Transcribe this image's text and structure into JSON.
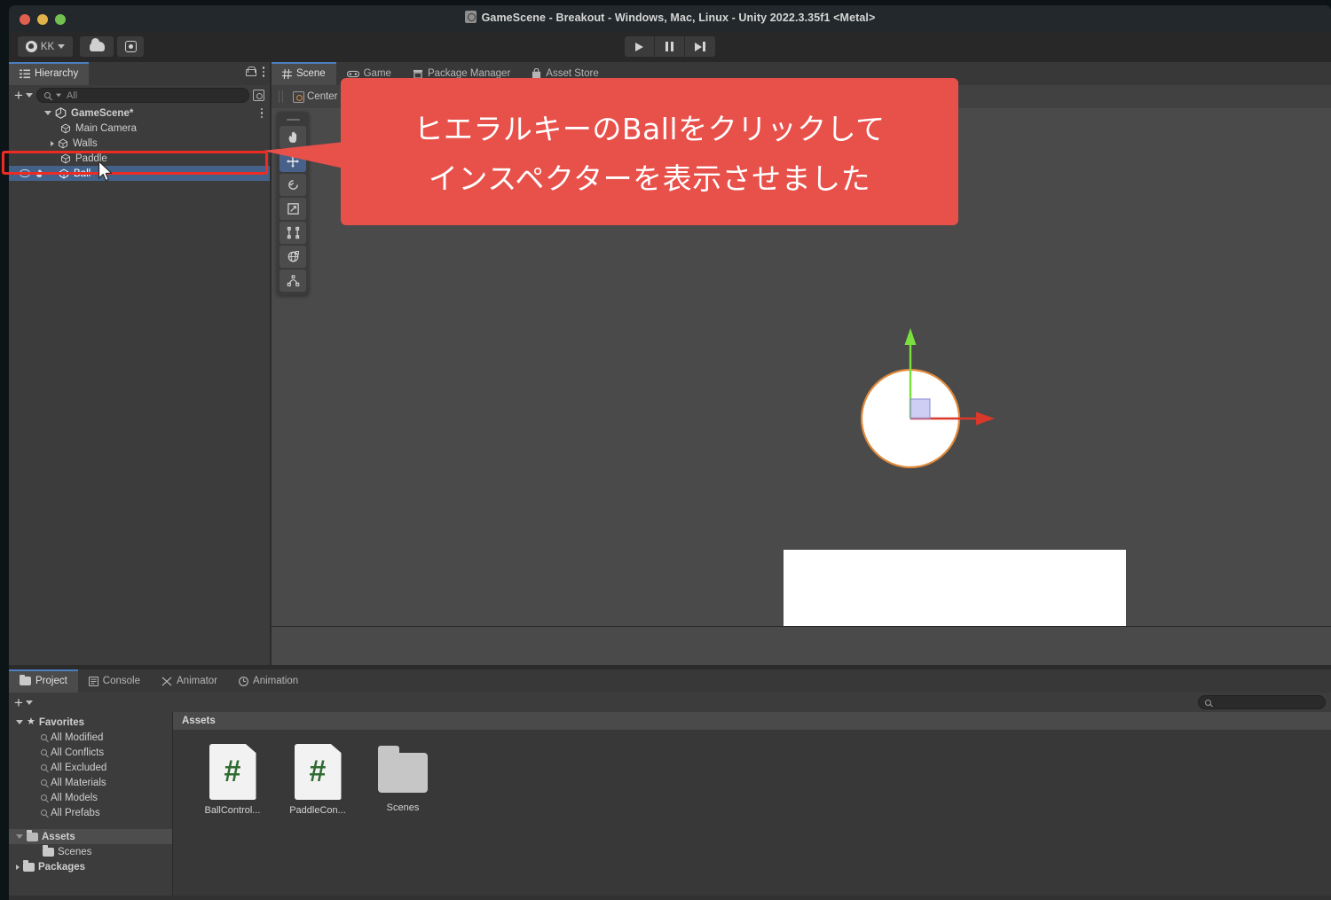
{
  "window": {
    "title": "GameScene - Breakout - Windows, Mac, Linux - Unity 2022.3.35f1 <Metal>",
    "traffic_lights": [
      "close",
      "minimize",
      "zoom"
    ],
    "colors": {
      "titlebar_bg": "#22282b",
      "panel_bg": "#3c3c3c",
      "scene_bg": "#4a4a4a",
      "selection_blue": "#44618a",
      "accent_red": "#e8504a",
      "annotation_outline": "#ee2b22",
      "tab_active_bar": "#4a7fc1",
      "csharp_green": "#2f6b32"
    }
  },
  "main_toolbar": {
    "account_label": "KK",
    "account_icon": "avatar-icon",
    "cloud_icon": "cloud-icon",
    "settings_icon": "gear-icon",
    "play_icon": "play-icon",
    "pause_icon": "pause-icon",
    "step_icon": "step-icon"
  },
  "hierarchy": {
    "tab_label": "Hierarchy",
    "tab_icon": "hierarchy-icon",
    "lock_icon": "lock-icon",
    "menu_icon": "kebab-menu-icon",
    "add_label": "+",
    "search_placeholder": "All",
    "search_value": "",
    "expand_icon": "scene-vis-icon",
    "items": [
      {
        "label": "GameScene*",
        "icon": "unity-scene-icon",
        "indent": 0,
        "arrow": "open",
        "selected": false,
        "bold": true
      },
      {
        "label": "Main Camera",
        "icon": "gameobject-cube-icon",
        "indent": 1,
        "arrow": "none",
        "selected": false,
        "bold": false
      },
      {
        "label": "Walls",
        "icon": "gameobject-cube-icon",
        "indent": 1,
        "arrow": "closed",
        "selected": false,
        "bold": false
      },
      {
        "label": "Paddle",
        "icon": "gameobject-cube-icon",
        "indent": 1,
        "arrow": "none",
        "selected": false,
        "bold": false
      },
      {
        "label": "Ball",
        "icon": "gameobject-cube-icon",
        "indent": 1,
        "arrow": "none",
        "selected": true,
        "bold": false
      }
    ]
  },
  "scene_panel": {
    "tabs": [
      {
        "label": "Scene",
        "icon": "grid-icon",
        "active": true
      },
      {
        "label": "Game",
        "icon": "gamepad-icon",
        "active": false
      },
      {
        "label": "Package Manager",
        "icon": "package-icon",
        "active": false
      },
      {
        "label": "Asset Store",
        "icon": "store-bag-icon",
        "active": false
      }
    ],
    "pivot_label": "Center",
    "pivot_icon": "pivot-center-icon",
    "tools": [
      {
        "name": "hand-tool-icon",
        "active": false
      },
      {
        "name": "move-tool-icon",
        "active": true
      },
      {
        "name": "rotate-tool-icon",
        "active": false
      },
      {
        "name": "scale-tool-icon",
        "active": false
      },
      {
        "name": "rect-tool-icon",
        "active": false
      },
      {
        "name": "transform-tool-icon",
        "active": false
      },
      {
        "name": "custom-tool-icon",
        "active": false
      }
    ],
    "objects": [
      {
        "name": "ball-sphere",
        "shape": "circle",
        "fill": "#ffffff",
        "outline": "#e08a3c"
      },
      {
        "name": "paddle-rect",
        "shape": "rect",
        "fill": "#ffffff"
      }
    ],
    "gizmo": {
      "name": "move-gizmo",
      "y_axis_color": "#79e040",
      "x_axis_color": "#d9382a",
      "plane_handle_color": "#b4b4ee"
    }
  },
  "project_panel": {
    "tabs": [
      {
        "label": "Project",
        "icon": "folder-icon",
        "active": true
      },
      {
        "label": "Console",
        "icon": "console-icon",
        "active": false
      },
      {
        "label": "Animator",
        "icon": "animator-icon",
        "active": false
      },
      {
        "label": "Animation",
        "icon": "animation-clock-icon",
        "active": false
      }
    ],
    "add_label": "+",
    "search_placeholder": "",
    "search_value": "",
    "tree": [
      {
        "label": "Favorites",
        "icon": "star-icon",
        "indent": 0,
        "arrow": "open",
        "selected": false,
        "bold": true
      },
      {
        "label": "All Modified",
        "icon": "search-icon",
        "indent": 1,
        "arrow": "none",
        "selected": false,
        "bold": false
      },
      {
        "label": "All Conflicts",
        "icon": "search-icon",
        "indent": 1,
        "arrow": "none",
        "selected": false,
        "bold": false
      },
      {
        "label": "All Excluded",
        "icon": "search-icon",
        "indent": 1,
        "arrow": "none",
        "selected": false,
        "bold": false
      },
      {
        "label": "All Materials",
        "icon": "search-icon",
        "indent": 1,
        "arrow": "none",
        "selected": false,
        "bold": false
      },
      {
        "label": "All Models",
        "icon": "search-icon",
        "indent": 1,
        "arrow": "none",
        "selected": false,
        "bold": false
      },
      {
        "label": "All Prefabs",
        "icon": "search-icon",
        "indent": 1,
        "arrow": "none",
        "selected": false,
        "bold": false
      },
      {
        "label": "Assets",
        "icon": "folder-open-icon",
        "indent": 0,
        "arrow": "open",
        "selected": true,
        "bold": true
      },
      {
        "label": "Scenes",
        "icon": "folder-icon",
        "indent": 1,
        "arrow": "none",
        "selected": false,
        "bold": false
      },
      {
        "label": "Packages",
        "icon": "folder-icon",
        "indent": 0,
        "arrow": "closed",
        "selected": false,
        "bold": true
      }
    ],
    "content_header": "Assets",
    "assets": [
      {
        "label": "BallControl...",
        "icon": "csharp-script-icon",
        "glyph": "#"
      },
      {
        "label": "PaddleCon...",
        "icon": "csharp-script-icon",
        "glyph": "#"
      },
      {
        "label": "Scenes",
        "icon": "folder-icon",
        "glyph": ""
      }
    ]
  },
  "annotation": {
    "line1": "ヒエラルキーのBallをクリックして",
    "line2": "インスペクターを表示させました",
    "callout_color": "#e8504a",
    "highlight_target": "Ball"
  }
}
